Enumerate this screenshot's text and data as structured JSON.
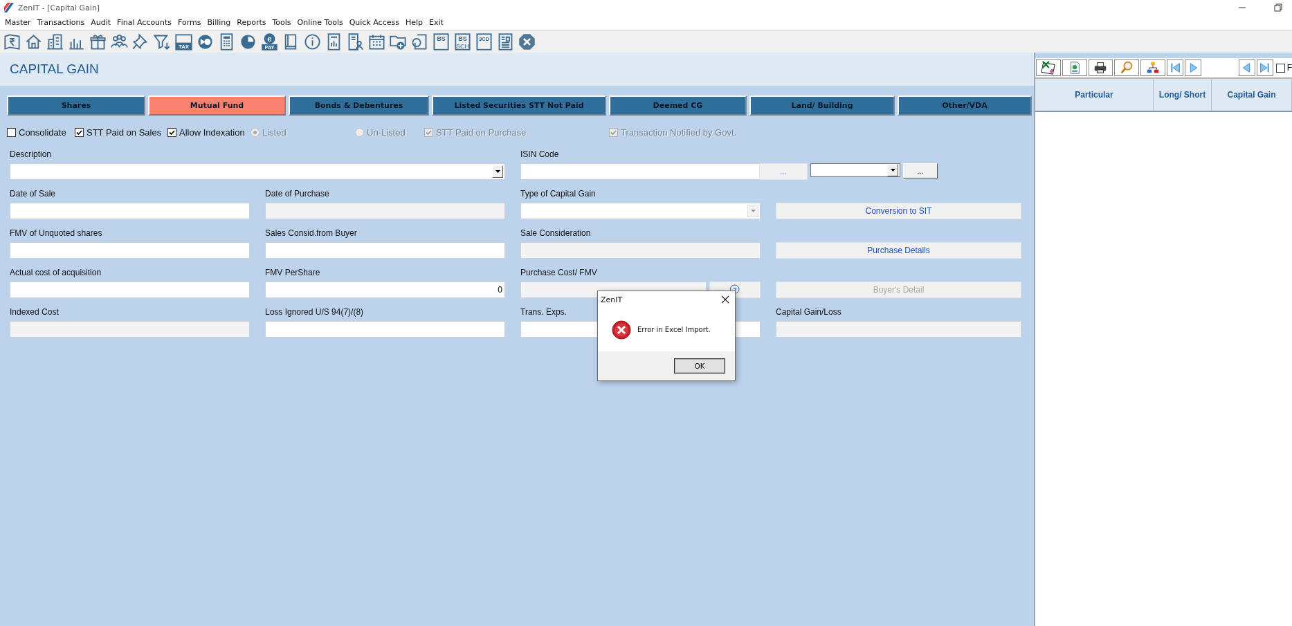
{
  "window": {
    "title": "ZenIT - [Capital Gain]"
  },
  "menu": [
    "Master",
    "Transactions",
    "Audit",
    "Final Accounts",
    "Forms",
    "Billing",
    "Reports",
    "Tools",
    "Online Tools",
    "Quick Access",
    "Help",
    "Exit"
  ],
  "toolbar": [
    {
      "kind": "rupee"
    },
    {
      "kind": "home"
    },
    {
      "kind": "building"
    },
    {
      "kind": "bars"
    },
    {
      "kind": "gift"
    },
    {
      "kind": "people"
    },
    {
      "kind": "pin"
    },
    {
      "kind": "filter"
    },
    {
      "kind": "tax",
      "label": "TAX"
    },
    {
      "kind": "circle-arrow"
    },
    {
      "kind": "calculator"
    },
    {
      "kind": "pie"
    },
    {
      "kind": "epay",
      "label": "e",
      "sublabel": "PAY"
    },
    {
      "kind": "book"
    },
    {
      "kind": "info"
    },
    {
      "kind": "report"
    },
    {
      "kind": "user-doc"
    },
    {
      "kind": "calendar"
    },
    {
      "kind": "folder-add"
    },
    {
      "kind": "doc-circle"
    },
    {
      "kind": "bs",
      "label": "BS"
    },
    {
      "kind": "bs",
      "label": "BS",
      "sublabel": "SCH"
    },
    {
      "kind": "bs",
      "label": "3CD"
    },
    {
      "kind": "ledger"
    },
    {
      "kind": "close"
    }
  ],
  "page_title": "CAPITAL GAIN",
  "tabs": [
    {
      "label": "Shares",
      "selected": false
    },
    {
      "label": "Mutual Fund",
      "selected": true
    },
    {
      "label": "Bonds & Debentures",
      "selected": false
    },
    {
      "label": "Listed Securities STT Not Paid",
      "selected": false
    },
    {
      "label": "Deemed CG",
      "selected": false
    },
    {
      "label": "Land/ Building",
      "selected": false
    },
    {
      "label": "Other/VDA",
      "selected": false
    }
  ],
  "options": [
    {
      "kind": "checkbox",
      "label": "Consolidate",
      "checked": false,
      "disabled": false
    },
    {
      "kind": "checkbox",
      "label": "STT Paid on Sales",
      "checked": true,
      "disabled": false
    },
    {
      "kind": "checkbox",
      "label": "Allow Indexation",
      "checked": true,
      "disabled": false
    },
    {
      "kind": "radio",
      "label": "Listed",
      "checked": true,
      "disabled": true
    },
    {
      "kind": "radio",
      "label": "Un-Listed",
      "checked": false,
      "disabled": true
    },
    {
      "kind": "checkbox",
      "label": "STT Paid on Purchase",
      "checked": true,
      "disabled": true
    },
    {
      "kind": "checkbox",
      "label": "Transaction Notified by Govt.",
      "checked": true,
      "disabled": true
    }
  ],
  "form": {
    "rows": [
      [
        {
          "label": "Description",
          "controls": [
            {
              "kind": "combo",
              "disabled": false
            }
          ]
        },
        "",
        {
          "label": "ISIN Code",
          "controls": [
            {
              "kind": "text",
              "disabled": false
            }
          ]
        },
        {
          "controls": [
            {
              "kind": "flat_button",
              "label": "...",
              "disabled": false
            },
            {
              "kind": "combo",
              "disabled": false
            },
            {
              "kind": "button",
              "label": "...",
              "disabled": false
            }
          ]
        }
      ],
      [
        {
          "label": "Date of Sale",
          "controls": [
            {
              "kind": "text",
              "disabled": false
            }
          ]
        },
        {
          "label": "Date of Purchase",
          "controls": [
            {
              "kind": "text",
              "disabled": true
            }
          ]
        },
        {
          "label": "Type of Capital Gain",
          "controls": [
            {
              "kind": "combo",
              "disabled": true
            }
          ]
        },
        {
          "controls": [
            {
              "kind": "flat_button",
              "label": "Conversion to SIT",
              "disabled": false
            }
          ]
        }
      ],
      [
        {
          "label": "FMV of Unquoted shares",
          "controls": [
            {
              "kind": "text",
              "disabled": false
            }
          ]
        },
        {
          "label": "Sales Consid.from Buyer",
          "controls": [
            {
              "kind": "text",
              "disabled": false
            }
          ]
        },
        {
          "label": "Sale Consideration",
          "controls": [
            {
              "kind": "text",
              "disabled": true
            }
          ]
        },
        {
          "controls": [
            {
              "kind": "flat_button",
              "label": "Purchase Details",
              "disabled": false
            }
          ]
        }
      ],
      [
        {
          "label": "Actual cost of acquisition",
          "controls": [
            {
              "kind": "text",
              "disabled": false
            }
          ]
        },
        {
          "label": "FMV PerShare",
          "controls": [
            {
              "kind": "text",
              "value": "0",
              "disabled": false
            }
          ]
        },
        {
          "label": "Purchase Cost/ FMV",
          "controls": [
            {
              "kind": "text",
              "disabled": true
            },
            {
              "kind": "help_button",
              "label": "?",
              "disabled": false
            }
          ]
        },
        {
          "controls": [
            {
              "kind": "flat_button",
              "label": "Buyer's Detail",
              "disabled": true
            }
          ]
        }
      ],
      [
        {
          "label": "Indexed Cost",
          "controls": [
            {
              "kind": "text",
              "disabled": true
            }
          ]
        },
        {
          "label": "Loss Ignored U/S 94(7)/(8)",
          "controls": [
            {
              "kind": "text",
              "disabled": false
            }
          ]
        },
        {
          "label": "Trans. Exps.",
          "controls": [
            {
              "kind": "text",
              "disabled": false
            }
          ]
        },
        {
          "label": "Capital Gain/Loss",
          "controls": [
            {
              "kind": "text",
              "disabled": true
            }
          ]
        }
      ]
    ]
  },
  "dialog": {
    "title": "ZenIT",
    "message": "Error in Excel Import.",
    "buttons": [
      "OK"
    ]
  },
  "side_panel": {
    "toolbar": [
      {
        "kind": "excel"
      },
      {
        "kind": "web-doc"
      },
      {
        "kind": "printer"
      },
      {
        "kind": "search"
      },
      {
        "kind": "hierarchy"
      },
      {
        "kind": "first"
      },
      {
        "kind": "next"
      },
      {
        "kind": "spacer"
      },
      {
        "kind": "previous"
      },
      {
        "kind": "last"
      }
    ],
    "checkbox": {
      "label": "F",
      "checked": false
    },
    "columns": [
      "Particular",
      "Long/ Short",
      "Capital Gain"
    ]
  }
}
